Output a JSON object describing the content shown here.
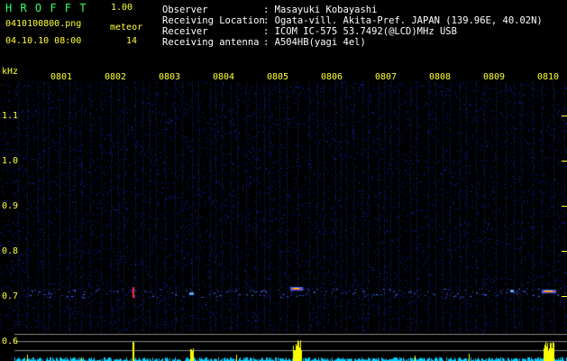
{
  "header": {
    "logo": "H R O F F T",
    "version": "1.00",
    "filename": "0410100800.png",
    "datetime": "04.10.10 08:00",
    "meteor_label": "meteor",
    "meteor_count": "14"
  },
  "info": {
    "rows": [
      {
        "label": "Observer",
        "value": ": Masayuki Kobayashi"
      },
      {
        "label": "Receiving Location",
        "value": ": Ogata-vill. Akita-Pref. JAPAN (139.96E, 40.02N)"
      },
      {
        "label": "Receiver",
        "value": ": ICOM IC-575 53.7492(@LCD)MHz USB"
      },
      {
        "label": "Receiving antenna",
        "value": ": A504HB(yagi 4el)"
      }
    ]
  },
  "axes": {
    "y_unit": "kHz",
    "y_ticks": [
      "1.1",
      "1.0",
      "0.9",
      "0.8",
      "0.7",
      "0.6"
    ],
    "x_ticks": [
      "0801",
      "0802",
      "0803",
      "0804",
      "0805",
      "0806",
      "0807",
      "0808",
      "0809",
      "0810"
    ]
  },
  "colors": {
    "background": "#000000",
    "noise": "#0a1e8c",
    "label": "#ffff33",
    "logo": "#33ff66",
    "echo": "#ff3333",
    "level": "#ffff00",
    "level_low": "#00d0ff"
  }
}
